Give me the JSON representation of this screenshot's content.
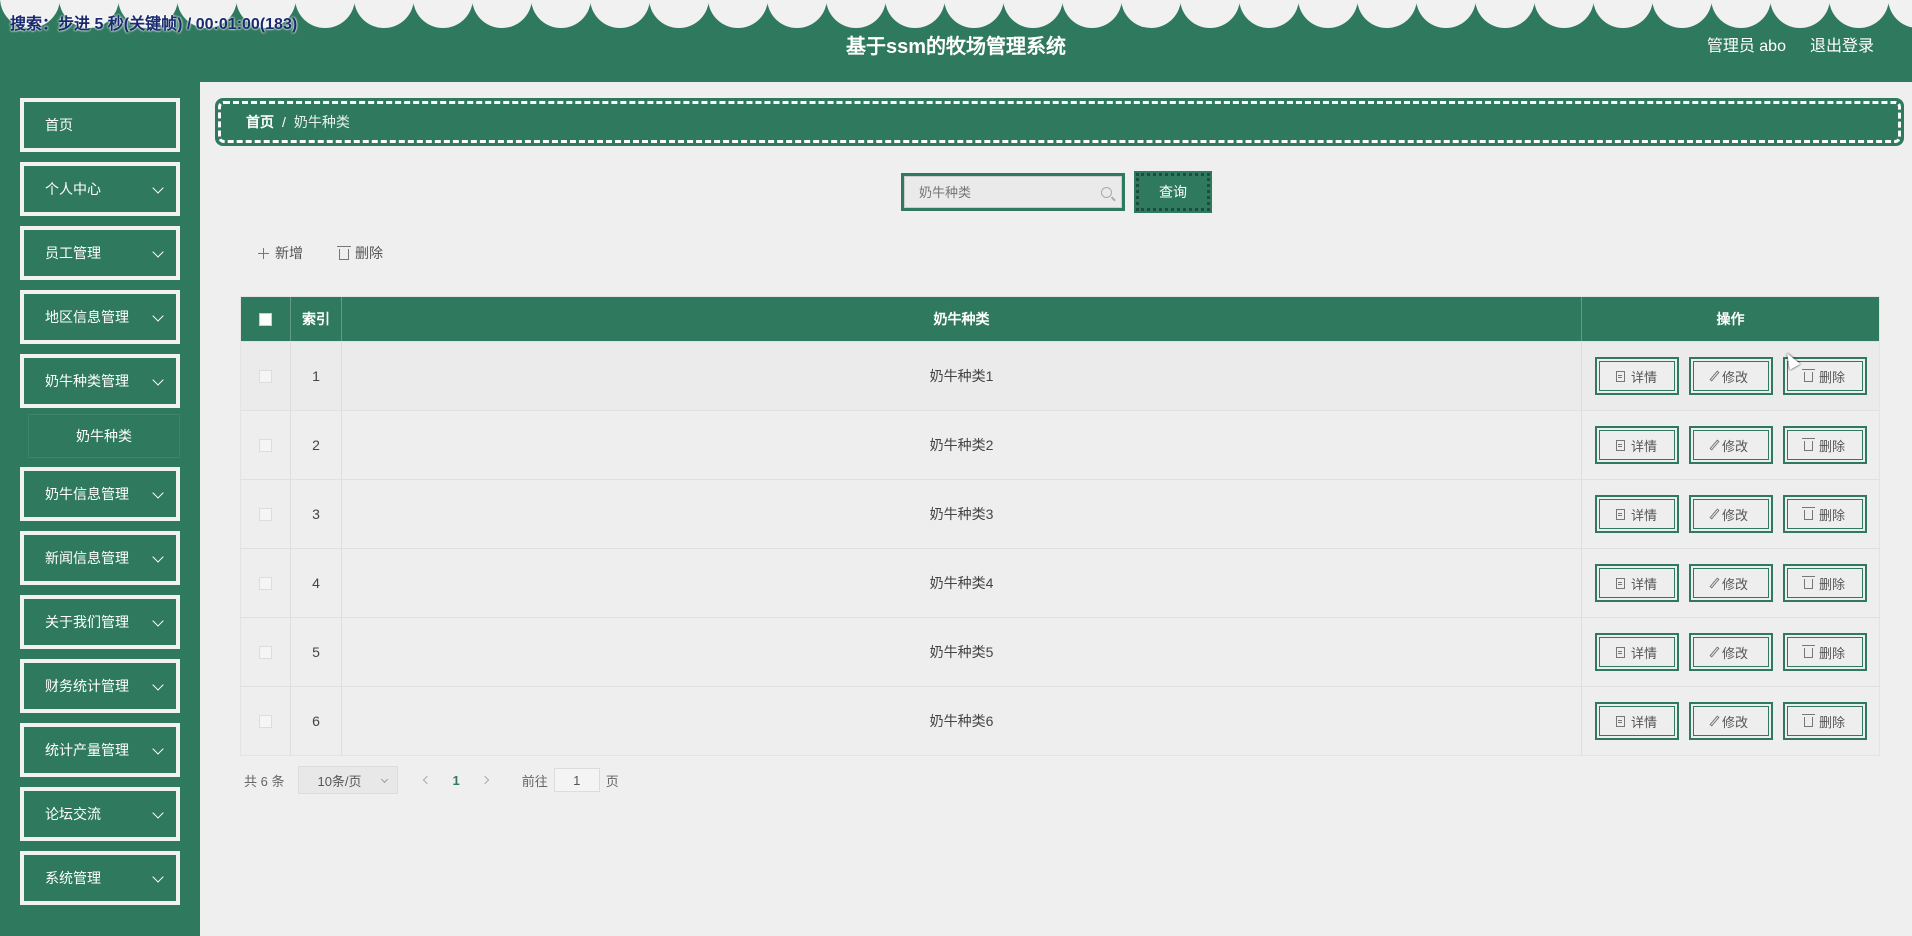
{
  "overlay": {
    "text": "搜索：步进 5 秒(关键帧) / 00:01:00(183)"
  },
  "header": {
    "title": "基于ssm的牧场管理系统",
    "user_label": "管理员 abo",
    "logout_label": "退出登录"
  },
  "sidebar": {
    "items": [
      {
        "label": "首页"
      },
      {
        "label": "个人中心"
      },
      {
        "label": "员工管理"
      },
      {
        "label": "地区信息管理"
      },
      {
        "label": "奶牛种类管理"
      },
      {
        "label": "奶牛信息管理"
      },
      {
        "label": "新闻信息管理"
      },
      {
        "label": "关于我们管理"
      },
      {
        "label": "财务统计管理"
      },
      {
        "label": "统计产量管理"
      },
      {
        "label": "论坛交流"
      },
      {
        "label": "系统管理"
      }
    ],
    "submenu": {
      "label": "奶牛种类"
    }
  },
  "breadcrumb": {
    "home": "首页",
    "separator": "/",
    "current": "奶牛种类"
  },
  "search": {
    "placeholder": "奶牛种类",
    "button_label": "查询"
  },
  "toolbar": {
    "add_label": "新增",
    "delete_label": "删除"
  },
  "table": {
    "headers": {
      "index": "索引",
      "name": "奶牛种类",
      "ops": "操作"
    },
    "rows": [
      {
        "index": "1",
        "name": "奶牛种类1"
      },
      {
        "index": "2",
        "name": "奶牛种类2"
      },
      {
        "index": "3",
        "name": "奶牛种类3"
      },
      {
        "index": "4",
        "name": "奶牛种类4"
      },
      {
        "index": "5",
        "name": "奶牛种类5"
      },
      {
        "index": "6",
        "name": "奶牛种类6"
      }
    ],
    "row_actions": {
      "detail": "详情",
      "edit": "修改",
      "delete": "删除"
    }
  },
  "pagination": {
    "total_label": "共 6 条",
    "page_size": "10条/页",
    "current_page": "1",
    "goto_label": "前往",
    "goto_value": "1",
    "page_suffix": "页"
  },
  "colors": {
    "primary": "#2f7a5e",
    "background": "#efefef"
  }
}
